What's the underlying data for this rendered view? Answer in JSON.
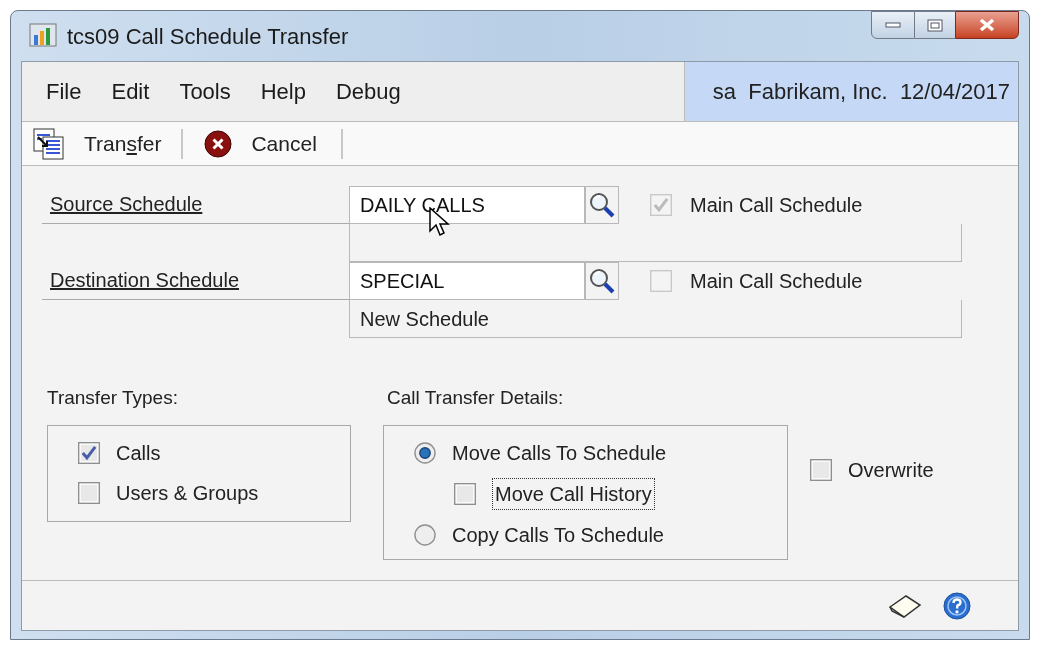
{
  "window": {
    "title": "tcs09 Call Schedule Transfer"
  },
  "menu": [
    "File",
    "Edit",
    "Tools",
    "Help",
    "Debug"
  ],
  "user_info": "sa  Fabrikam, Inc.  12/04/2017",
  "toolbar": [
    {
      "kind": "transfer",
      "label": "Tran",
      "accel": "s",
      "rest": "fer"
    },
    {
      "kind": "cancel",
      "label": "Cancel"
    }
  ],
  "schedules": [
    {
      "label": "Source Schedule",
      "value": "DAILY CALLS",
      "main_label": "Main Call Schedule",
      "main_checked": true,
      "main_disabled": true
    },
    {
      "label": "Destination Schedule",
      "value": "SPECIAL",
      "description": "New Schedule",
      "main_label": "Main Call Schedule",
      "main_checked": false,
      "main_disabled": true
    }
  ],
  "transfer_types": {
    "title": "Transfer Types:",
    "items": [
      {
        "label": "Calls",
        "checked": true
      },
      {
        "label": "Users & Groups",
        "checked": false
      }
    ]
  },
  "details": {
    "title": "Call Transfer Details:",
    "options": [
      {
        "kind": "radio",
        "label": "Move Calls To Schedule",
        "selected": true
      },
      {
        "kind": "checkbox",
        "label": "Move Call History",
        "checked": false,
        "focused": true
      },
      {
        "kind": "radio",
        "label": "Copy Calls To Schedule",
        "selected": false
      }
    ]
  },
  "overwrite": {
    "label": "Overwrite",
    "checked": false
  }
}
